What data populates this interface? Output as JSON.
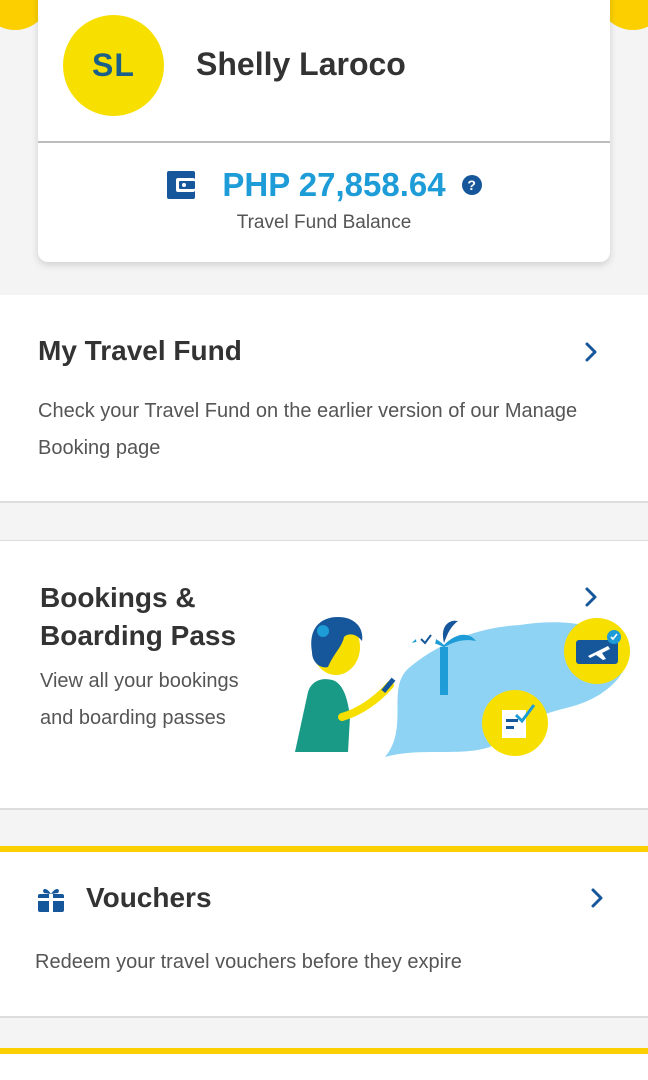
{
  "profile": {
    "initials": "SL",
    "name": "Shelly Laroco",
    "balance": "PHP 27,858.64",
    "balance_label": "Travel Fund Balance",
    "help_symbol": "?"
  },
  "travel_fund": {
    "title": "My Travel Fund",
    "description": "Check your Travel Fund on the earlier version of our Manage Booking page"
  },
  "bookings": {
    "title": "Bookings & Boarding Pass",
    "description": "View all your bookings and boarding passes"
  },
  "vouchers": {
    "title": "Vouchers",
    "description": "Redeem your travel vouchers before they expire"
  },
  "icons": {
    "wallet": "wallet-icon",
    "help": "help-circle-icon",
    "chevron": "chevron-right-icon",
    "gift": "gift-icon"
  },
  "colors": {
    "accent_yellow": "#fcd000",
    "balance_blue": "#1e9cd7",
    "icon_navy": "#16579b"
  }
}
